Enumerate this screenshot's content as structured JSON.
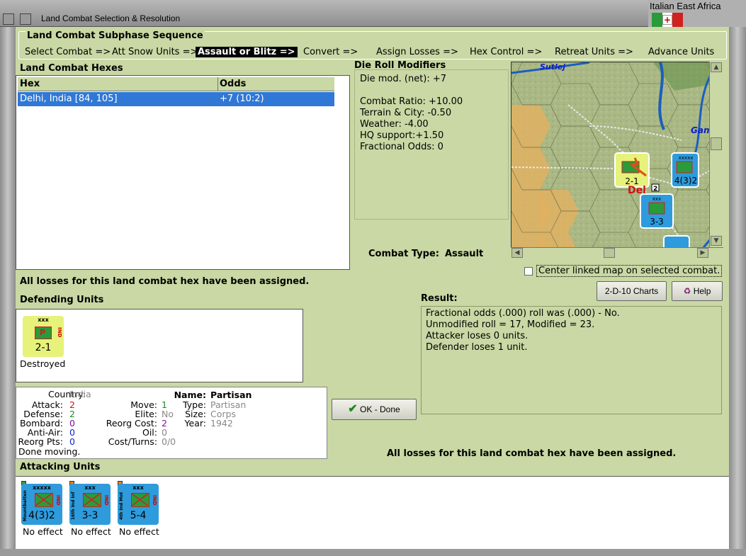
{
  "window": {
    "title": "Land Combat Selection & Resolution",
    "nation": "Italian East Africa"
  },
  "sequence": {
    "title": "Land Combat Subphase Sequence",
    "steps": [
      "Select Combat =>",
      "Att Snow Units =>",
      "Assault or Blitz =>",
      "Convert =>",
      "Assign Losses =>",
      "Hex Control =>",
      "Retreat Units =>",
      "Advance Units"
    ],
    "active_index": 2
  },
  "hexes": {
    "label": "Land Combat Hexes",
    "columns": [
      "Hex",
      "Odds"
    ],
    "rows": [
      [
        "Delhi, India [84, 105]",
        "+7 (10:2)"
      ]
    ]
  },
  "modifiers": {
    "label": "Die Roll Modifiers",
    "net": "Die mod. (net): +7",
    "combat_ratio": "Combat Ratio: +10.00",
    "terrain": "Terrain & City: -0.50",
    "weather": "Weather: -4.00",
    "hq": "HQ support:+1.50",
    "fractional": "Fractional Odds: 0"
  },
  "map": {
    "label_sutlej": "Sutlej",
    "label_ganges": "Gan",
    "label_delhi": "Del",
    "badge": "2"
  },
  "combat_type": {
    "label": "Combat Type:",
    "value": "Assault"
  },
  "losses_msg": "All losses for this land combat hex have been assigned.",
  "center_map": {
    "label": "Center linked map on selected combat.",
    "checked": false
  },
  "buttons": {
    "charts": "2-D-10 Charts",
    "help": "Help",
    "ok": "OK - Done"
  },
  "result": {
    "label": "Result:",
    "lines": [
      "Fractional odds (.000) roll was (.000)  - No.",
      "Unmodified roll = 17, Modified = 23.",
      "Attacker loses 0 units.",
      "Defender loses 1 unit."
    ]
  },
  "defending": {
    "label": "Defending Units",
    "units": [
      {
        "size": "xxx",
        "strength": "2-1",
        "nat": "IND",
        "letter": "P",
        "status": "Destroyed"
      }
    ]
  },
  "details": {
    "country_label": "Country:",
    "country": "India",
    "attack_label": "Attack:",
    "attack": "2",
    "defense_label": "Defense:",
    "defense": "2",
    "bombard_label": "Bombard:",
    "bombard": "0",
    "antiair_label": "Anti-Air:",
    "antiair": "0",
    "reorgpts_label": "Reorg Pts:",
    "reorgpts": "0",
    "done": "Done moving.",
    "move_label": "Move:",
    "move": "1",
    "elite_label": "Elite:",
    "elite": "No",
    "reorgcost_label": "Reorg Cost:",
    "reorgcost": "2",
    "oil_label": "Oil:",
    "oil": "0",
    "costturns_label": "Cost/Turns:",
    "costturns": "0/0",
    "name_label": "Name:",
    "name": "Partisan",
    "type_label": "Type:",
    "type": "Partisan",
    "size_label": "Size:",
    "size": "Corps",
    "year_label": "Year:",
    "year": "1942"
  },
  "attacking": {
    "label": "Attacking Units",
    "units": [
      {
        "size": "xxxxx",
        "strength": "4(3)2",
        "nat": "IND",
        "stripe": "Mountbatten",
        "status": "No effect"
      },
      {
        "size": "xxx",
        "strength": "3-3",
        "nat": "IND",
        "stripe": "16th Ind Inf",
        "status": "No effect"
      },
      {
        "size": "xxx",
        "strength": "5-4",
        "nat": "IND",
        "stripe": "4th Ind Mot",
        "status": "No effect"
      }
    ]
  },
  "map_units": [
    {
      "size": "xxxxx",
      "strength": "4(3)2"
    },
    {
      "size": "xxx",
      "strength": "3-3"
    },
    {
      "size": "xxx",
      "strength": "2-1"
    }
  ],
  "colors": {
    "panel": "#c9d8a4",
    "selection": "#2f78d6",
    "unit_blue": "#2e9bdc",
    "unit_yellow": "#e6f27a",
    "red": "#d01010",
    "green": "#1a8a1a",
    "blue": "#1020d0",
    "purple": "#8010a0"
  }
}
